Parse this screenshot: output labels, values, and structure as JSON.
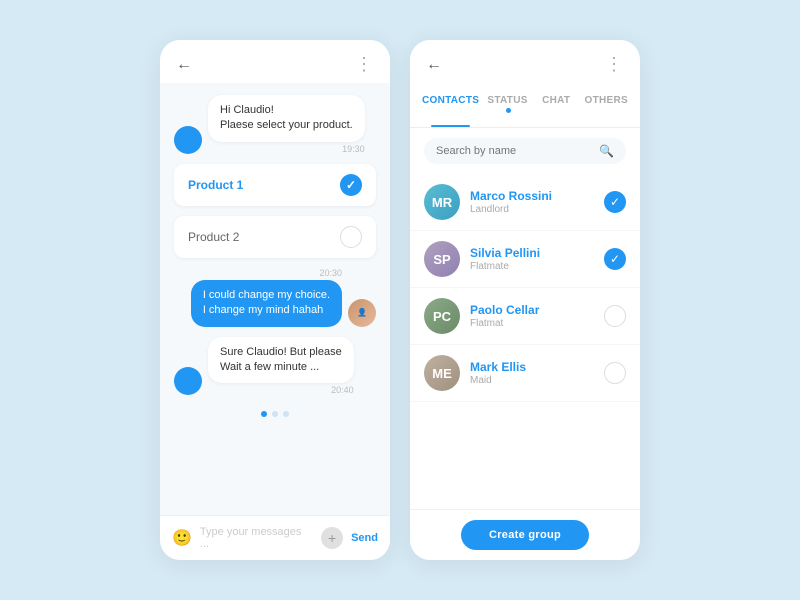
{
  "chat": {
    "header": {
      "back_label": "←",
      "menu_label": "⋮"
    },
    "messages": [
      {
        "type": "received",
        "text_line1": "Hi Claudio!",
        "text_line2": "Plaese select your product.",
        "time": "19:30",
        "has_avatar": true
      }
    ],
    "product1": {
      "label": "Product 1",
      "selected": true
    },
    "product2": {
      "label": "Product 2",
      "selected": false
    },
    "msg_sent": {
      "text_line1": "I could change my choice.",
      "text_line2": "I change my mind hahah",
      "time": "20:30"
    },
    "msg_received2": {
      "text_line1": "Sure Claudio! But please",
      "text_line2": "Wait a few minute ...",
      "time": "20:40"
    },
    "pagination_dots": [
      "active",
      "inactive",
      "inactive"
    ],
    "input": {
      "placeholder": "Type your messages ...",
      "send_label": "Send"
    }
  },
  "contacts": {
    "header": {
      "back_label": "←",
      "menu_label": "⋮"
    },
    "tabs": [
      {
        "label": "CONTACTS",
        "active": true,
        "dot": false
      },
      {
        "label": "STATUS",
        "active": false,
        "dot": true
      },
      {
        "label": "CHAT",
        "active": false,
        "dot": false
      },
      {
        "label": "OTHERS",
        "active": false,
        "dot": false
      }
    ],
    "search": {
      "placeholder": "Search by name"
    },
    "contacts_list": [
      {
        "name": "Marco Rossini",
        "role": "Landlord",
        "checked": true,
        "color": "#5bbcd4",
        "initials": "MR"
      },
      {
        "name": "Silvia Pellini",
        "role": "Flatmate",
        "checked": true,
        "color": "#b0a0c0",
        "initials": "SP"
      },
      {
        "name": "Paolo Cellar",
        "role": "Flatmat",
        "checked": false,
        "color": "#8aaa88",
        "initials": "PC"
      },
      {
        "name": "Mark Ellis",
        "role": "Maid",
        "checked": false,
        "color": "#c0b0a0",
        "initials": "ME"
      }
    ],
    "create_group_btn": "Create group"
  }
}
